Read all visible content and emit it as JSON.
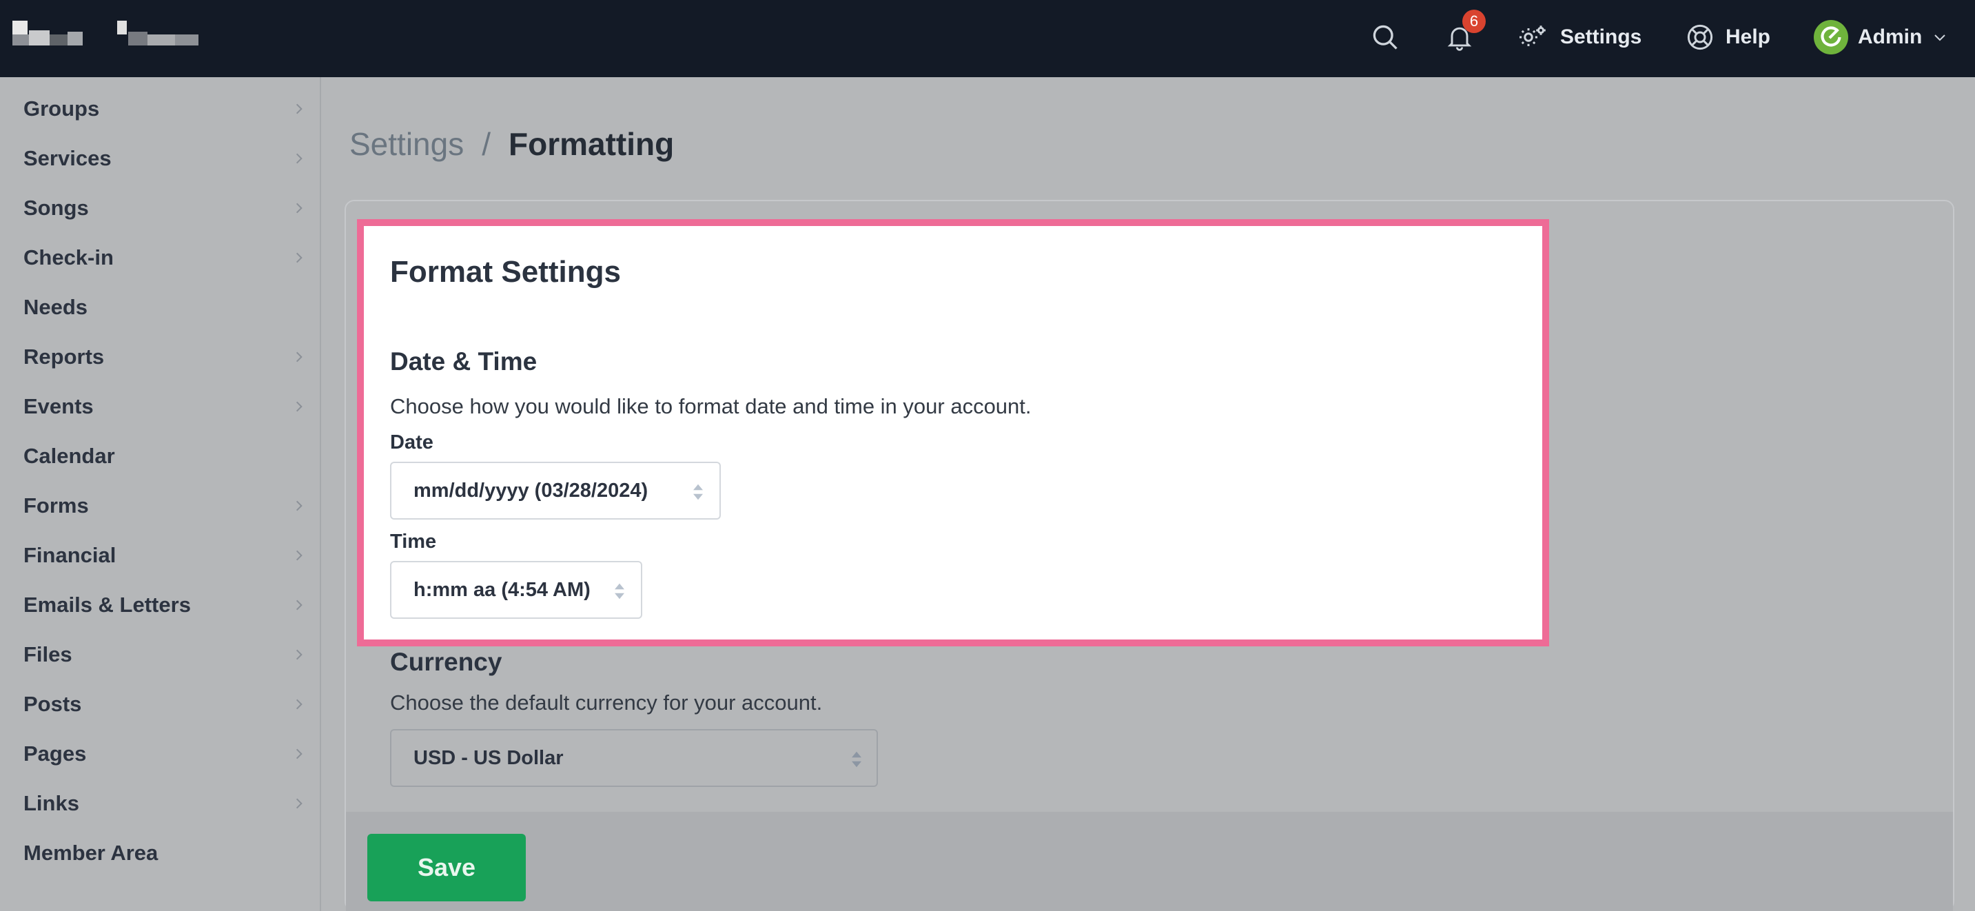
{
  "topnav": {
    "notification_count": "6",
    "settings_label": "Settings",
    "help_label": "Help",
    "user_label": "Admin"
  },
  "sidebar": {
    "items": [
      {
        "label": "Groups",
        "chevron": true
      },
      {
        "label": "Services",
        "chevron": true
      },
      {
        "label": "Songs",
        "chevron": true
      },
      {
        "label": "Check-in",
        "chevron": true
      },
      {
        "label": "Needs",
        "chevron": false
      },
      {
        "label": "Reports",
        "chevron": true
      },
      {
        "label": "Events",
        "chevron": true
      },
      {
        "label": "Calendar",
        "chevron": false
      },
      {
        "label": "Forms",
        "chevron": true
      },
      {
        "label": "Financial",
        "chevron": true
      },
      {
        "label": "Emails & Letters",
        "chevron": true
      },
      {
        "label": "Files",
        "chevron": true
      },
      {
        "label": "Posts",
        "chevron": true
      },
      {
        "label": "Pages",
        "chevron": true
      },
      {
        "label": "Links",
        "chevron": true
      },
      {
        "label": "Member Area",
        "chevron": false
      }
    ]
  },
  "breadcrumb": {
    "parent": "Settings",
    "separator": "/",
    "current": "Formatting"
  },
  "format": {
    "title": "Format Settings",
    "datetime": {
      "heading": "Date & Time",
      "description": "Choose how you would like to format date and time in your account.",
      "date_label": "Date",
      "date_value": "mm/dd/yyyy (03/28/2024)",
      "time_label": "Time",
      "time_value": "h:mm aa (4:54 AM)"
    },
    "currency": {
      "heading": "Currency",
      "description": "Choose the default currency for your account.",
      "value": "USD - US Dollar"
    },
    "save_label": "Save"
  },
  "colors": {
    "nav_bg": "#131a26",
    "highlight_border": "#ee6b96",
    "save_green": "#18a158",
    "badge_red": "#d9432f",
    "avatar_green": "#6fb33c"
  },
  "icons": {
    "search": "search-icon",
    "notifications": "bell-icon",
    "settings": "gear-icon",
    "help": "lifebuoy-icon",
    "avatar": "avatar-icon",
    "dropdown": "chevron-down-icon",
    "select_arrows": "sort-arrows-icon"
  }
}
